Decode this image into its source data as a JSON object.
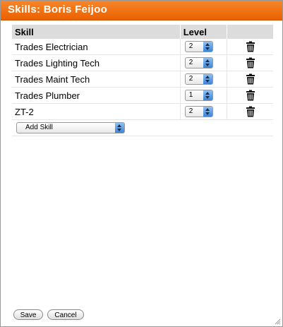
{
  "dialog": {
    "title": "Skills: Boris Feijoo"
  },
  "table": {
    "headers": {
      "skill": "Skill",
      "level": "Level"
    },
    "rows": [
      {
        "skill": "Trades Electrician",
        "level": "2"
      },
      {
        "skill": "Trades Lighting Tech",
        "level": "2"
      },
      {
        "skill": "Trades Maint Tech",
        "level": "2"
      },
      {
        "skill": "Trades Plumber",
        "level": "1"
      },
      {
        "skill": "ZT-2",
        "level": "2"
      }
    ],
    "add_skill": "Add Skill"
  },
  "buttons": {
    "save": "Save",
    "cancel": "Cancel"
  },
  "colors": {
    "title_bar": "#ea6100",
    "header_bg": "#dcdcdc",
    "select_arrow": "#3b84d8"
  },
  "icons": {
    "delete": "trash-icon",
    "select": "up-down-arrows-icon"
  }
}
